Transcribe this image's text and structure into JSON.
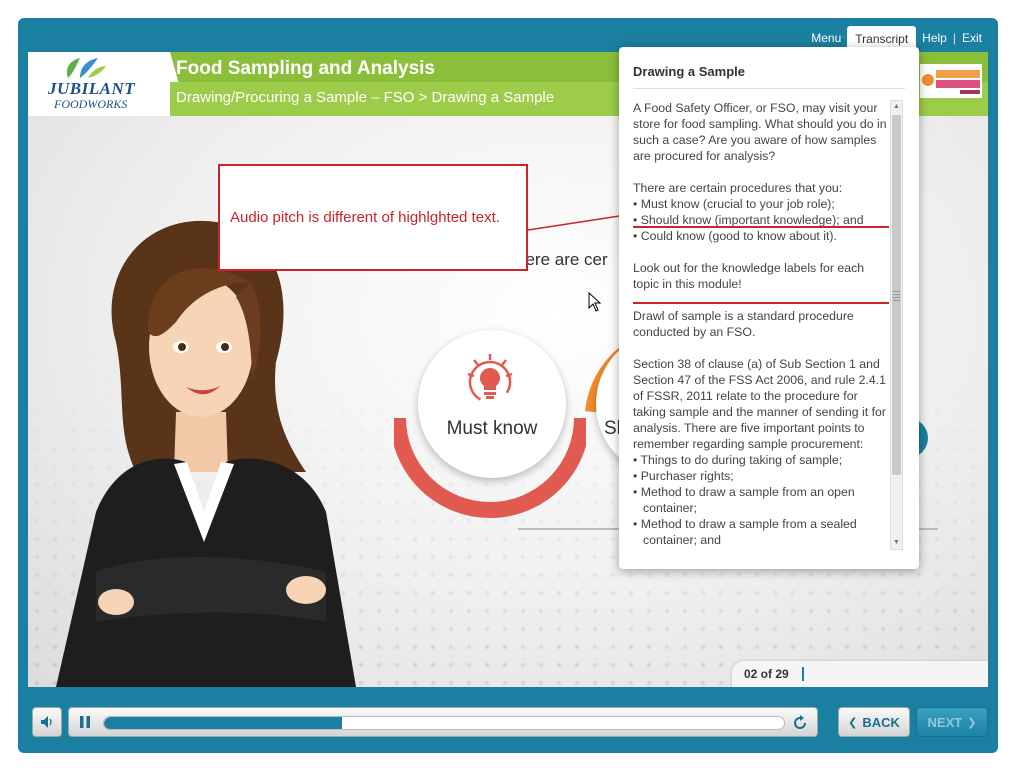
{
  "nav": {
    "menu": "Menu",
    "transcript": "Transcript",
    "help": "Help",
    "exit": "Exit",
    "sep": "|"
  },
  "header": {
    "logo_line1": "JUBILANT",
    "logo_line2": "FOODWORKS",
    "title": "Food Sampling and Analysis",
    "subtitle": "Drawing/Procuring a Sample – FSO > Drawing a Sample",
    "brand_right": "DUNKIN' DONUTS"
  },
  "stage": {
    "heading": "here are cer",
    "must_know": "Must know",
    "should_know_partial": "Sh"
  },
  "annotation": {
    "text": "Audio pitch is different of highlghted text."
  },
  "transcript": {
    "title": "Drawing a Sample",
    "para1": "A Food Safety Officer, or FSO, may visit your store for food sampling. What should you do in such a case? Are you aware of how samples are procured for analysis?",
    "para2_intro": "There are certain procedures that you:",
    "para2_items": [
      "Must know (crucial to your job role);",
      "Should know (important knowledge); and",
      "Could know (good to know about it)."
    ],
    "para3": "Look out for the knowledge labels for each topic in this module!",
    "para4": "Drawl of sample is a standard procedure conducted by an FSO.",
    "para5": "Section 38 of clause (a) of Sub Section 1 and Section 47 of the FSS Act 2006, and rule 2.4.1 of FSSR, 2011 relate to the procedure for taking sample and the manner of sending it for analysis. There are five important points to remember regarding sample procurement:",
    "para5_items": [
      "Things to do during taking of sample;",
      "Purchaser rights;",
      "Method to draw a sample from an open container;",
      "Method to draw a sample from a sealed container; and"
    ]
  },
  "counter": {
    "text": "02 of 29"
  },
  "controls": {
    "back": "BACK",
    "next": "NEXT",
    "progress_fraction": 0.35
  },
  "colors": {
    "frame": "#1a7fa0",
    "header_green": "#8bbf3b",
    "annotation_red": "#c8242b",
    "must_know_red": "#e05a4f",
    "should_know_orange": "#f08c2a"
  },
  "icons": {
    "volume": "speaker-icon",
    "pause": "pause-icon",
    "replay": "replay-icon",
    "back": "chevron-left-icon",
    "next": "chevron-right-icon",
    "must_know": "lightbulb-icon"
  }
}
